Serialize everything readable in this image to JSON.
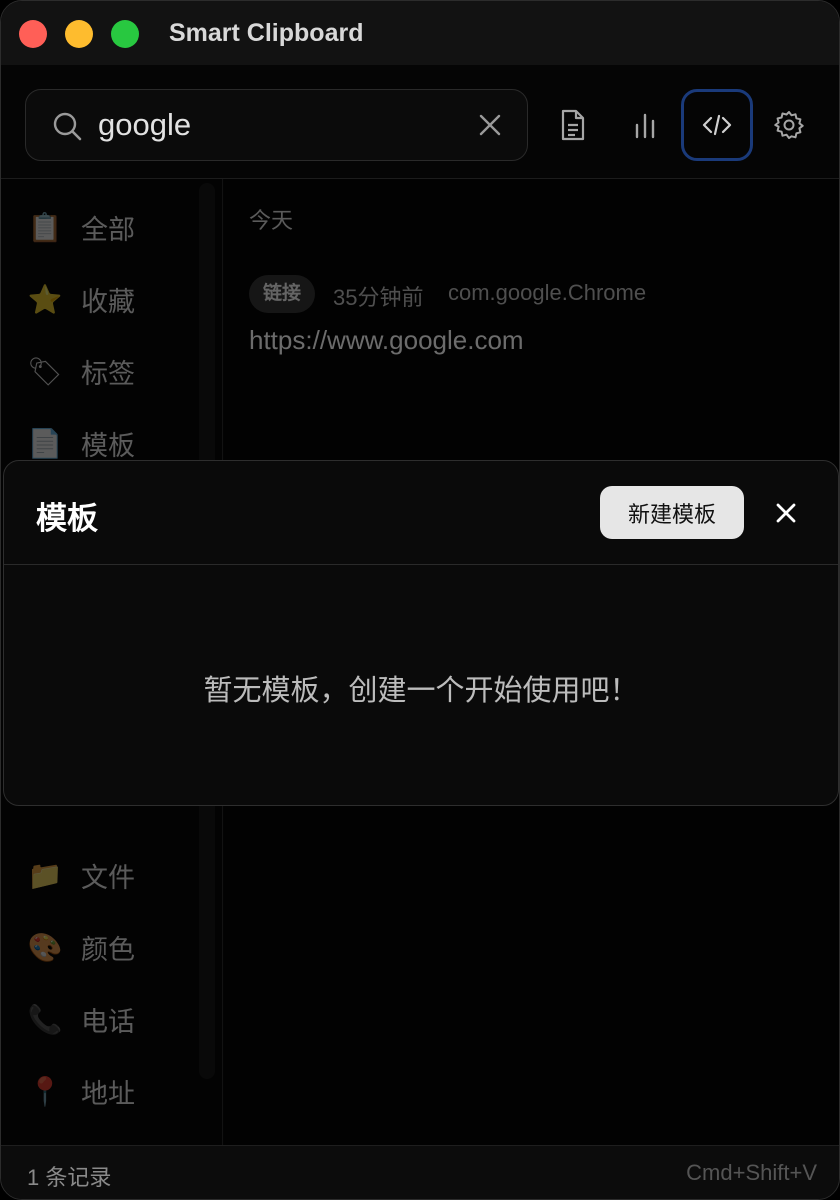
{
  "window": {
    "title": "Smart Clipboard"
  },
  "search": {
    "value": "google"
  },
  "sidebar": {
    "items": [
      {
        "label": "全部",
        "icon": "clipboard-icon",
        "glyph": "📋"
      },
      {
        "label": "收藏",
        "icon": "star-icon",
        "glyph": "⭐"
      },
      {
        "label": "标签",
        "icon": "tag-icon",
        "glyph": "🏷"
      },
      {
        "label": "模板",
        "icon": "document-icon",
        "glyph": "📄"
      },
      {
        "label": "文件",
        "icon": "folder-icon",
        "glyph": "📁"
      },
      {
        "label": "颜色",
        "icon": "palette-icon",
        "glyph": "🎨"
      },
      {
        "label": "电话",
        "icon": "phone-icon",
        "glyph": "📞"
      },
      {
        "label": "地址",
        "icon": "pin-icon",
        "glyph": "📍"
      }
    ]
  },
  "main": {
    "group_title": "今天",
    "entry": {
      "badge": "链接",
      "time": "35分钟前",
      "source": "com.google.Chrome",
      "text": "https://www.google.com"
    }
  },
  "status": {
    "count": "1 条记录",
    "shortcut": "Cmd+Shift+V"
  },
  "modal": {
    "title": "模板",
    "new_button": "新建模板",
    "empty_message": "暂无模板，创建一个开始使用吧！"
  },
  "colors": {
    "accent_ring": "#1a3a7a",
    "background": "#060606"
  }
}
